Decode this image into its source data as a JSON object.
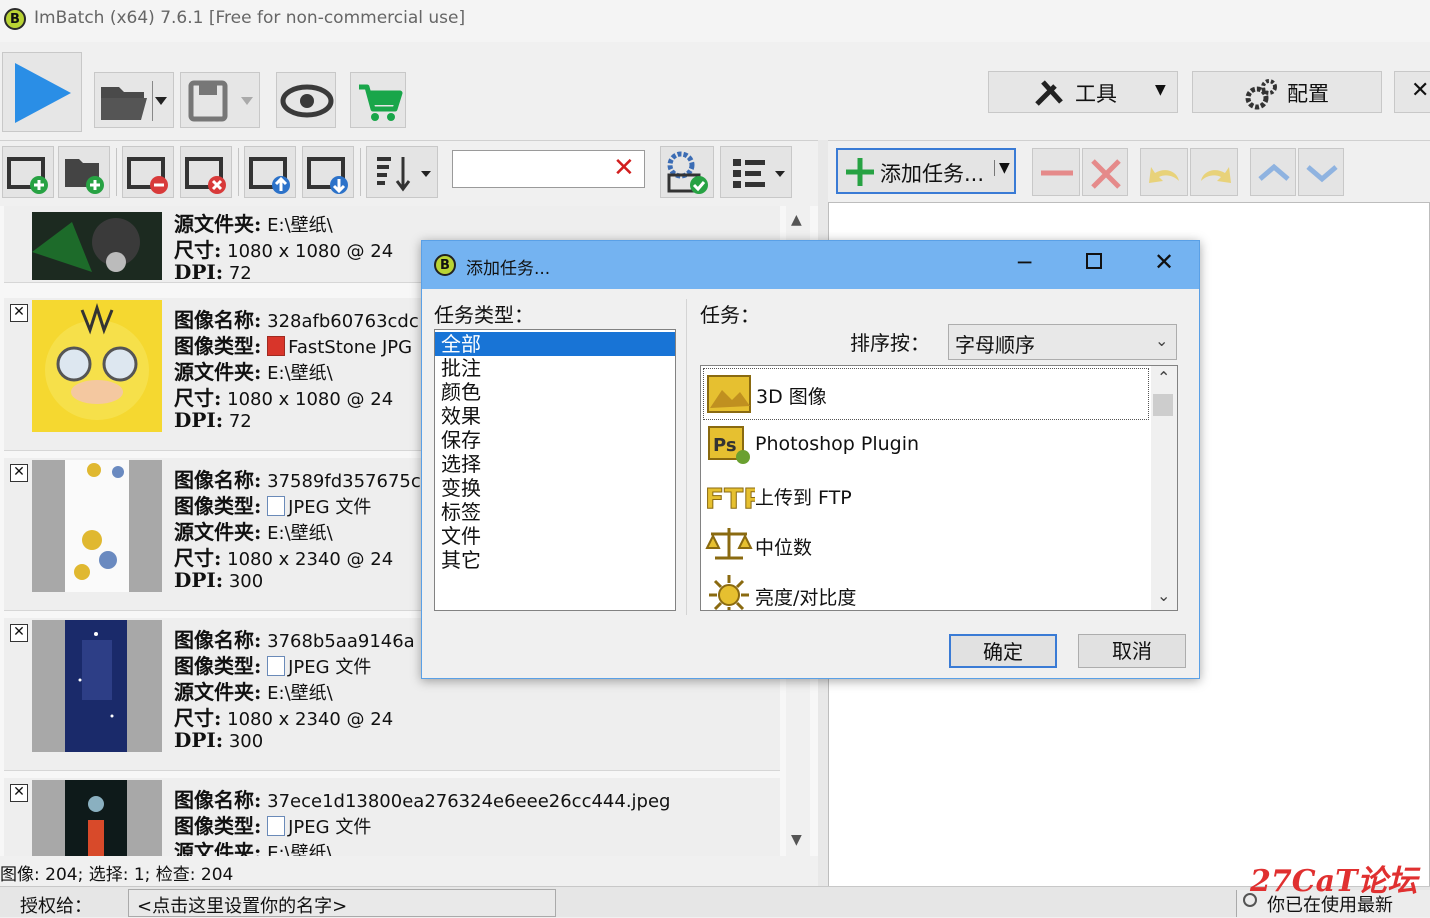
{
  "app": {
    "title": "ImBatch (x64) 7.6.1 [Free for non-commercial use]",
    "logo": "B"
  },
  "toolbar": {
    "run_icon": "play-icon",
    "tools_label": "工具",
    "config_label": "配置"
  },
  "search": {
    "value": ""
  },
  "task_toolbar": {
    "add_task_label": "添加任务..."
  },
  "image_list": {
    "labels": {
      "name": "图像名称:",
      "type": "图像类型:",
      "folder": "源文件夹:",
      "size": "尺寸:",
      "dpi": "DPI:"
    },
    "items": [
      {
        "name": "",
        "type": "",
        "folder": "E:\\壁纸\\",
        "size": "1080 x 1080 @ 24",
        "dpi": "72"
      },
      {
        "name": "328afb60763cdc",
        "type": "FastStone JPG",
        "folder": "E:\\壁纸\\",
        "size": "1080 x 1080 @ 24",
        "dpi": "72"
      },
      {
        "name": "37589fd357675c",
        "type": "JPEG 文件",
        "folder": "E:\\壁纸\\",
        "size": "1080 x 2340 @ 24",
        "dpi": "300"
      },
      {
        "name": "3768b5aa9146a",
        "type": "JPEG 文件",
        "folder": "E:\\壁纸\\",
        "size": "1080 x 2340 @ 24",
        "dpi": "300"
      },
      {
        "name": "37ece1d13800ea276324e6eee26cc444.jpeg",
        "type": "JPEG 文件",
        "folder": "E:\\壁纸\\",
        "size": "",
        "dpi": ""
      }
    ]
  },
  "status_bar": {
    "summary": "图像: 204; 选择: 1; 检查: 204",
    "license_label": "授权给：",
    "license_value": "<点击这里设置你的名字>",
    "update_status": "你已在使用最新"
  },
  "dialog": {
    "title": "添加任务...",
    "logo": "B",
    "category_label": "任务类型：",
    "task_label": "任务：",
    "sort_label": "排序按：",
    "sort_value": "字母顺序",
    "categories": [
      "全部",
      "批注",
      "颜色",
      "效果",
      "保存",
      "选择",
      "变换",
      "标签",
      "文件",
      "其它"
    ],
    "tasks": [
      {
        "label": "3D 图像",
        "icon": "3d-image-icon"
      },
      {
        "label": "Photoshop Plugin",
        "icon": "photoshop-plugin-icon"
      },
      {
        "label": "上传到 FTP",
        "icon": "ftp-icon"
      },
      {
        "label": "中位数",
        "icon": "balance-scale-icon"
      },
      {
        "label": "亮度/对比度",
        "icon": "brightness-icon"
      }
    ],
    "ok_label": "确定",
    "cancel_label": "取消"
  },
  "watermark": "27CaT论坛"
}
